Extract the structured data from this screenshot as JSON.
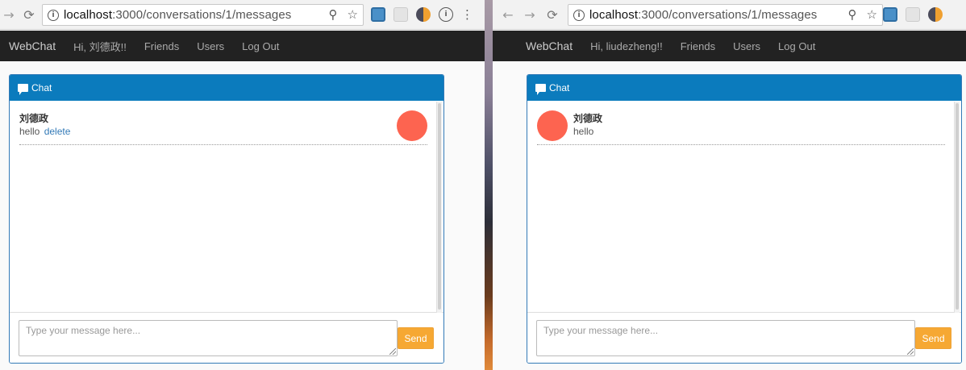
{
  "browser": {
    "url_host": "localhost",
    "url_path": ":3000/conversations/1/messages",
    "info_glyph": "i",
    "zoom_glyph": "⚲",
    "star_glyph": "☆",
    "menu_glyph": "⋮"
  },
  "left": {
    "nav": {
      "brand": "WebChat",
      "greeting": "Hi, 刘德政!!",
      "friends": "Friends",
      "users": "Users",
      "logout": "Log Out"
    },
    "panel": {
      "title": "Chat"
    },
    "messages": [
      {
        "author": "刘德政",
        "text": "hello",
        "action": "delete"
      }
    ],
    "composer": {
      "placeholder": "Type your message here...",
      "send_label": "Send"
    }
  },
  "right": {
    "nav": {
      "brand": "WebChat",
      "greeting": "Hi, liudezheng!!",
      "friends": "Friends",
      "users": "Users",
      "logout": "Log Out"
    },
    "panel": {
      "title": "Chat"
    },
    "messages": [
      {
        "author": "刘德政",
        "text": "hello"
      }
    ],
    "composer": {
      "placeholder": "Type your message here...",
      "send_label": "Send"
    }
  },
  "colors": {
    "navbar": "#222222",
    "panel_heading": "#0b7bbd",
    "avatar": "#fd6450",
    "send_button": "#f6a833",
    "link": "#337ab7"
  }
}
